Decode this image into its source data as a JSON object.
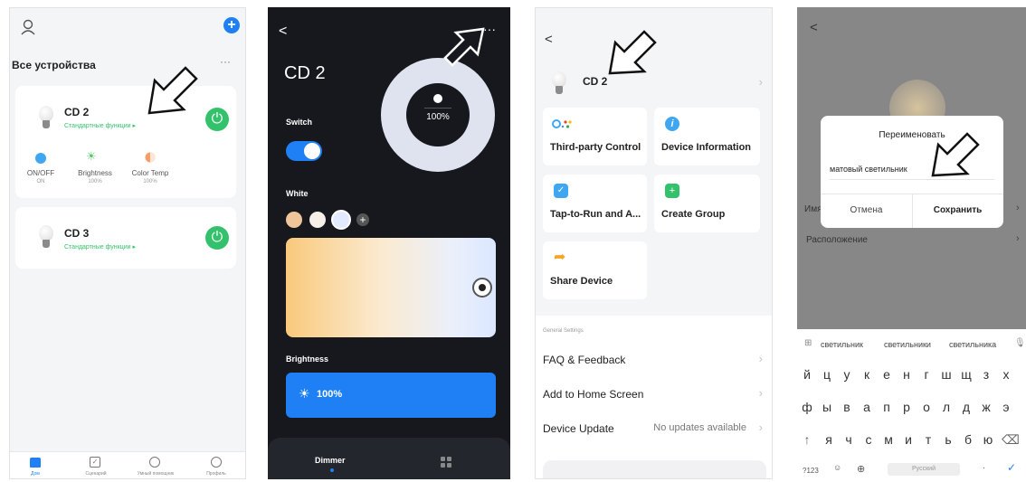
{
  "panel1": {
    "title": "Все устройства",
    "more": "···",
    "devices": [
      {
        "name": "CD 2",
        "subtitle": "Стандартные функции ▸"
      },
      {
        "name": "CD 3",
        "subtitle": "Стандартные функции ▸"
      }
    ],
    "controls": [
      {
        "label": "ON/OFF",
        "value": "ON"
      },
      {
        "label": "Brightness",
        "value": "100%"
      },
      {
        "label": "Color Temp",
        "value": "100%"
      }
    ],
    "bottom_nav": [
      "Дом",
      "Сценарий",
      "Умный помощник",
      "Профиль"
    ],
    "add_glyph": "+"
  },
  "panel2": {
    "back": "<",
    "more": "···",
    "title": "CD 2",
    "switch_label": "Switch",
    "white_label": "White",
    "brightness_label": "Brightness",
    "brightness_value": "100%",
    "dial_value": "100%",
    "tab_dimmer": "Dimmer",
    "switch_on": true,
    "accent": "#1f80f5"
  },
  "panel3": {
    "back": "<",
    "device_name": "CD 2",
    "tiles": [
      "Third-party Control",
      "Device Information",
      "Tap-to-Run and A...",
      "Create Group",
      "Share Device"
    ],
    "section": "General Settings",
    "rows": [
      {
        "label": "FAQ & Feedback",
        "value": ""
      },
      {
        "label": "Add to Home Screen",
        "value": ""
      },
      {
        "label": "Device Update",
        "value": "No updates available"
      }
    ]
  },
  "panel4": {
    "back": "<",
    "dialog_title": "Переименовать",
    "input_value": "матовый светильник",
    "cancel": "Отмена",
    "save": "Сохранить",
    "bg_row1": "Имя",
    "bg_row2": "Расположение",
    "suggestions": [
      "светильник",
      "светильники",
      "светильника"
    ],
    "keys_row1": [
      "й",
      "ц",
      "у",
      "к",
      "е",
      "н",
      "г",
      "ш",
      "щ",
      "з",
      "х"
    ],
    "keys_row2": [
      "ф",
      "ы",
      "в",
      "а",
      "п",
      "р",
      "о",
      "л",
      "д",
      "ж",
      "э"
    ],
    "keys_row3": [
      "я",
      "ч",
      "с",
      "м",
      "и",
      "т",
      "ь",
      "б",
      "ю"
    ],
    "key_123": "?123",
    "space_label": "Русский",
    "period": "."
  }
}
